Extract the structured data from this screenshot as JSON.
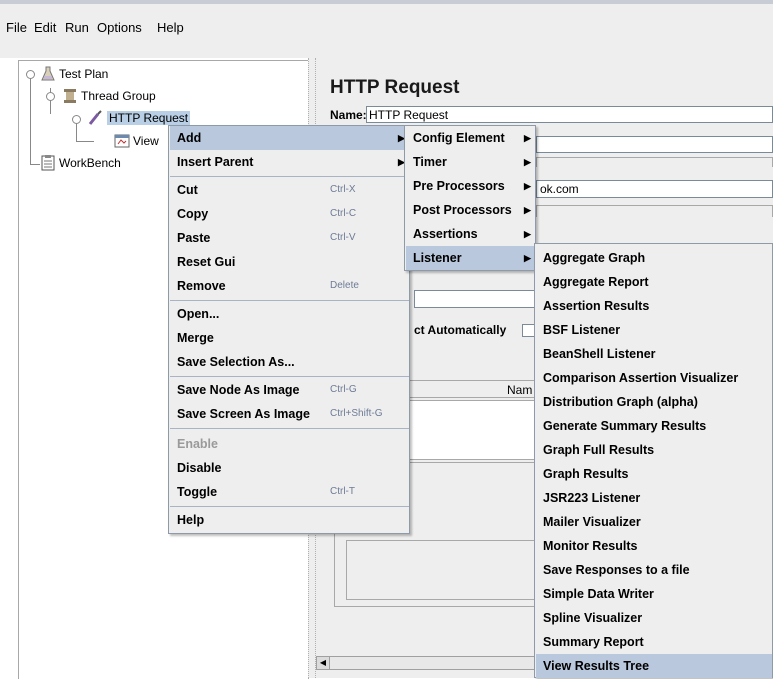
{
  "menubar": {
    "file": "File",
    "edit": "Edit",
    "run": "Run",
    "options": "Options",
    "help": "Help"
  },
  "tree": {
    "test_plan": "Test Plan",
    "thread_group": "Thread Group",
    "http_request": "HTTP Request",
    "view": "View",
    "workbench": "WorkBench"
  },
  "panel": {
    "title": "HTTP Request",
    "name_label": "Name:",
    "name_value": "HTTP Request",
    "server_fragment": "ok.com",
    "redirect_fragment": "ct Automatically",
    "name_col_fragment": "Nam"
  },
  "context_menu": {
    "items": [
      {
        "label": "Add",
        "submenu": true
      },
      {
        "label": "Insert Parent",
        "submenu": true
      },
      {
        "label": "Cut",
        "shortcut": "Ctrl-X"
      },
      {
        "label": "Copy",
        "shortcut": "Ctrl-C"
      },
      {
        "label": "Paste",
        "shortcut": "Ctrl-V"
      },
      {
        "label": "Reset Gui"
      },
      {
        "label": "Remove",
        "shortcut": "Delete"
      },
      {
        "label": "Open..."
      },
      {
        "label": "Merge"
      },
      {
        "label": "Save Selection As..."
      },
      {
        "label": "Save Node As Image",
        "shortcut": "Ctrl-G"
      },
      {
        "label": "Save Screen As Image",
        "shortcut": "Ctrl+Shift-G"
      },
      {
        "label": "Enable",
        "disabled": true
      },
      {
        "label": "Disable"
      },
      {
        "label": "Toggle",
        "shortcut": "Ctrl-T"
      },
      {
        "label": "Help"
      }
    ]
  },
  "add_submenu": {
    "items": [
      "Config Element",
      "Timer",
      "Pre Processors",
      "Post Processors",
      "Assertions",
      "Listener"
    ],
    "highlighted": "Listener"
  },
  "listener_submenu": {
    "items": [
      "Aggregate Graph",
      "Aggregate Report",
      "Assertion Results",
      "BSF Listener",
      "BeanShell Listener",
      "Comparison Assertion Visualizer",
      "Distribution Graph (alpha)",
      "Generate Summary Results",
      "Graph Full Results",
      "Graph Results",
      "JSR223 Listener",
      "Mailer Visualizer",
      "Monitor Results",
      "Save Responses to a file",
      "Simple Data Writer",
      "Spline Visualizer",
      "Summary Report",
      "View Results Tree"
    ],
    "highlighted": "View Results Tree"
  },
  "colors": {
    "highlight": "#b9c8dd",
    "menu_bg": "#eeeeee",
    "shortcut": "#6d7b96",
    "tree_selection": "#b8cfe5"
  }
}
